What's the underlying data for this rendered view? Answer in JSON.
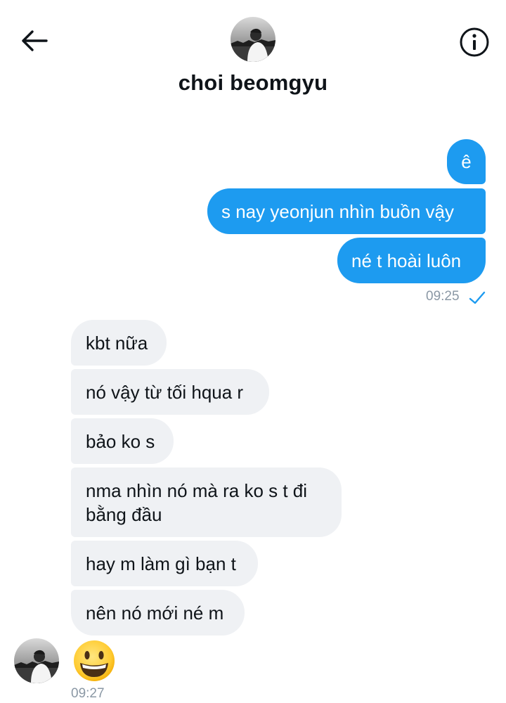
{
  "header": {
    "contact_name": "choi beomgyu",
    "back_icon": "arrow-left-icon",
    "info_icon": "info-icon"
  },
  "messages": {
    "sent": [
      {
        "text": "ê"
      },
      {
        "text": "s nay yeonjun nhìn buồn vậy"
      },
      {
        "text": "né t hoài luôn"
      }
    ],
    "sent_time": "09:25",
    "sent_status_icon": "check-icon",
    "received": [
      {
        "text": "kbt nữa"
      },
      {
        "text": "nó vậy từ tối hqua r"
      },
      {
        "text": "bảo ko s"
      },
      {
        "text": "nma nhìn nó mà ra ko s t đi bằng đầu"
      },
      {
        "text": "hay m làm gì bạn t"
      },
      {
        "text": "nên nó mới né m"
      }
    ],
    "emoji_message": "grinning-face-emoji",
    "received_time": "09:27"
  },
  "colors": {
    "sent_bubble": "#1d9bf0",
    "received_bubble": "#eff1f4",
    "timestamp": "#8b98a5",
    "check": "#1d9bf0"
  }
}
